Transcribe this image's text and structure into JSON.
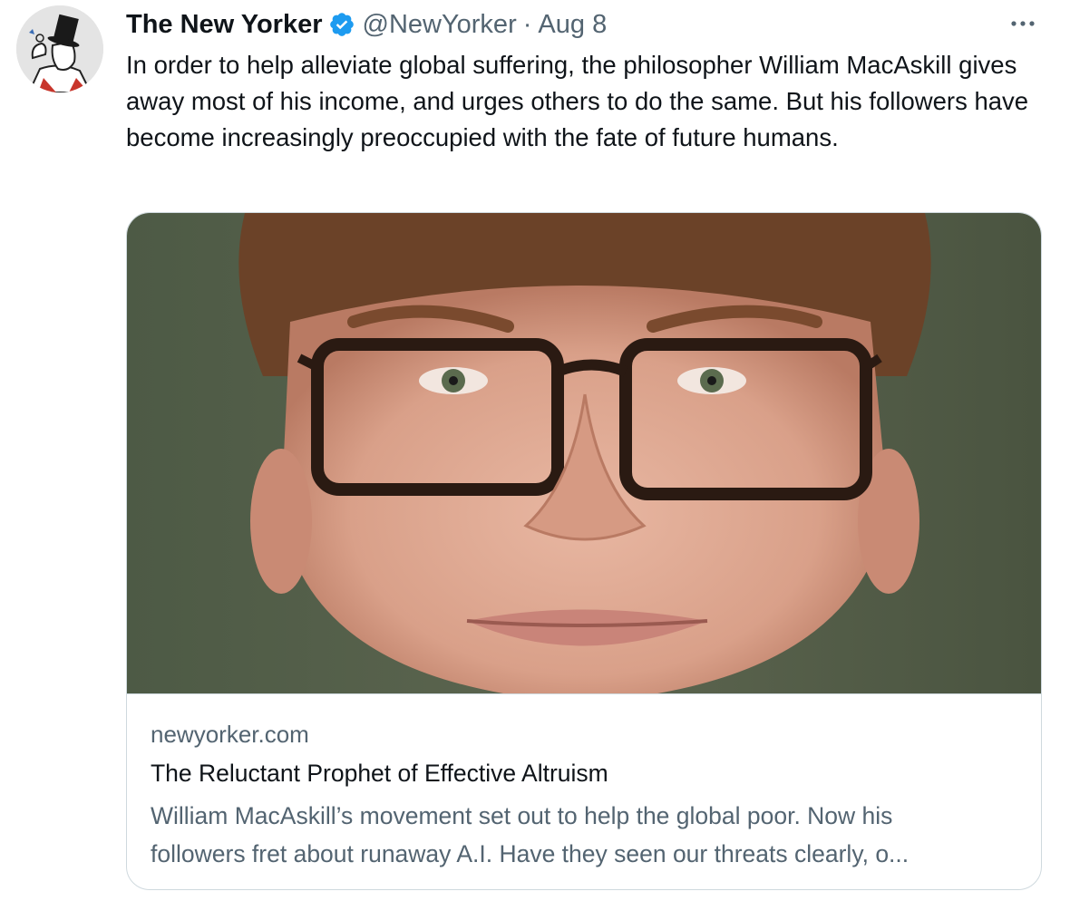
{
  "tweet": {
    "author": {
      "display_name": "The New Yorker",
      "handle": "@NewYorker",
      "verified": true,
      "avatar_icon": "eustace-tilley-avatar"
    },
    "separator": "·",
    "date": "Aug 8",
    "more_icon": "more-options-icon",
    "text": "In order to help alleviate global suffering, the philosopher William MacAskill gives away most of his income, and urges others to do the same. But his followers have become increasingly preoccupied with the fate of future humans."
  },
  "card": {
    "domain": "newyorker.com",
    "title": "The Reluctant Prophet of Effective Altruism",
    "description_line1": "William MacAskill’s movement set out to help the global poor. Now his",
    "description_line2": "followers fret about runaway A.I. Have they seen our threats clearly, o..."
  },
  "colors": {
    "text_primary": "#0f1419",
    "text_secondary": "#536471",
    "verified_blue": "#1d9bf0",
    "border": "#cfd9de"
  }
}
